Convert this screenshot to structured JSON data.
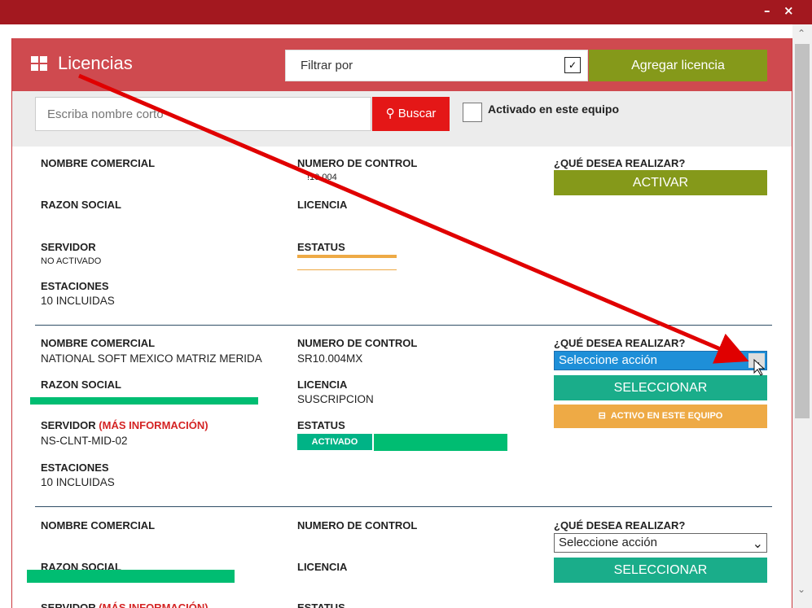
{
  "window": {
    "minimize": "–",
    "close": "×"
  },
  "header": {
    "title": "Licencias",
    "filter_label": "Filtrar por",
    "filter_arrow": "✓",
    "add_button": "Agregar licencia"
  },
  "search": {
    "placeholder": "Escriba nombre corto",
    "button": "Buscar",
    "checkbox_label": "Activado en este equipo"
  },
  "labels": {
    "nombre_comercial": "NOMBRE COMERCIAL",
    "numero_control": "NUMERO DE CONTROL",
    "que_desea": "¿QUÉ DESEA REALIZAR?",
    "razon_social": "RAZON SOCIAL",
    "licencia": "LICENCIA",
    "servidor": "SERVIDOR",
    "estatus": "ESTATUS",
    "estaciones": "ESTACIONES",
    "mas_info": "(MÁS INFORMACIÓN)"
  },
  "records": [
    {
      "nombre_comercial": "",
      "numero_control": "!10.004",
      "razon_social": "",
      "licencia": "",
      "servidor": "NO ACTIVADO",
      "estaciones": "10 INCLUIDAS",
      "action": "ACTIVAR"
    },
    {
      "nombre_comercial": "NATIONAL SOFT MEXICO MATRIZ MERIDA",
      "numero_control": "SR10.004MX",
      "razon_social": "",
      "licencia": "SUSCRIPCION",
      "servidor": "NS-CLNT-MID-02",
      "estatus_badge": "ACTIVADO",
      "estaciones": "10 INCLUIDAS",
      "select_value": "Seleccione acción",
      "select_arrow": "⌄",
      "action": "SELECCIONAR",
      "secondary_action": "ACTIVO EN ESTE EQUIPO"
    },
    {
      "nombre_comercial": "",
      "numero_control": "",
      "razon_social": "",
      "licencia": "",
      "select_value": "Seleccione acción",
      "select_arrow": "⌄",
      "action": "SELECCIONAR"
    }
  ],
  "colors": {
    "titlebar": "#a3181f",
    "header": "#cf4a4f",
    "add": "#85991a",
    "search": "#e41717",
    "green": "#00b386",
    "orange": "#eeaa45"
  }
}
